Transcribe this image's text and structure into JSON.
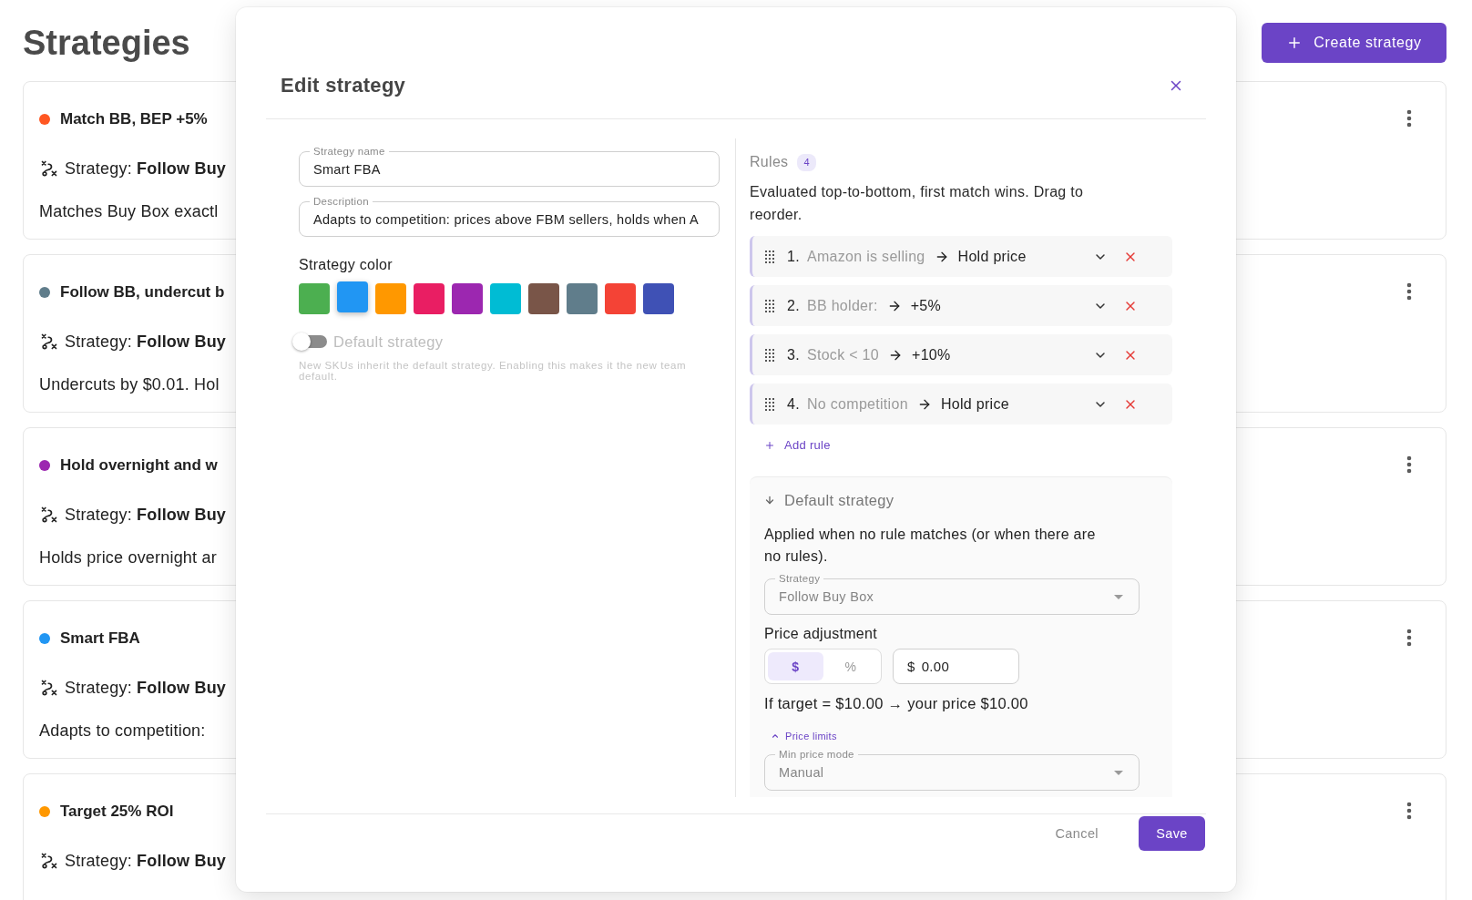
{
  "page": {
    "title": "Strategies",
    "create_button": "Create strategy"
  },
  "strategies": [
    {
      "name": "Match BB, BEP +5%",
      "color": "#ff5722",
      "strategy": "Strategy: **Follow Buy**",
      "description": "Matches Buy Box exactl"
    },
    {
      "name": "Follow BB, undercut b",
      "color": "#607d8b",
      "strategy": "Strategy: **Follow Buy**",
      "description": "Undercuts by $0.01. Hol"
    },
    {
      "name": "Hold overnight and w",
      "color": "#9c27b0",
      "strategy": "Strategy: **Follow Buy**",
      "description": "Holds price overnight ar"
    },
    {
      "name": "Smart FBA",
      "color": "#2196f3",
      "strategy": "Strategy: **Follow Buy**",
      "description": "Adapts to competition:"
    },
    {
      "name": "Target 25% ROI",
      "color": "#ff9800",
      "strategy": "Strategy: **Follow Buy**"
    }
  ],
  "dialog": {
    "title": "Edit strategy",
    "fields": [
      {
        "label": "Strategy name",
        "value": "Smart FBA"
      },
      {
        "label": "Description",
        "value": "Adapts to competition: prices above FBM sellers, holds when A"
      }
    ],
    "color_label": "Strategy color",
    "colors": [
      {
        "color": "#4caf50",
        "selected": false
      },
      {
        "color": "#2196f3",
        "selected": true
      },
      {
        "color": "#ff9800",
        "selected": false
      },
      {
        "color": "#e91e63",
        "selected": false
      },
      {
        "color": "#9c27b0",
        "selected": false
      },
      {
        "color": "#00bcd4",
        "selected": false
      },
      {
        "color": "#795548",
        "selected": false
      },
      {
        "color": "#607d8b",
        "selected": false
      },
      {
        "color": "#f44336",
        "selected": false
      },
      {
        "color": "#3f51b5",
        "selected": false
      }
    ],
    "default_toggle": {
      "label": "Default strategy",
      "on": false,
      "disabled": true,
      "help": "New SKUs inherit the default strategy. Enabling this makes it the new team default."
    },
    "rules": {
      "title": "Rules",
      "count": "4",
      "hint": "Evaluated top-to-bottom, first match wins. Drag to reorder.",
      "items": [
        {
          "number": "1.",
          "condition": "Amazon is selling",
          "action": "Hold price",
          "expanded": false
        },
        {
          "number": "2.",
          "condition": "BB holder:",
          "action": "+5%",
          "expanded": false
        },
        {
          "number": "3.",
          "condition": "Stock < 10",
          "action": "+10%",
          "expanded": false
        },
        {
          "number": "4.",
          "condition": "No competition",
          "action": "Hold price",
          "expanded": false
        }
      ],
      "add_label": "Add rule"
    },
    "fallback": {
      "title": "Default strategy",
      "text": "Applied when no rule matches (or when there are no rules).",
      "strategy_select": {
        "label": "Strategy",
        "value": "Follow Buy Box",
        "disabled": true
      },
      "adjustment_label": "Price adjustment",
      "units": [
        {
          "label": "$",
          "selected": true
        },
        {
          "label": "%",
          "selected": false
        }
      ],
      "amount": {
        "prefix": "$",
        "value": "0.00"
      },
      "preview": "If target = $10.00 → your price $10.00",
      "limits": {
        "label": "Price limits",
        "expanded": true
      },
      "min_mode": {
        "label": "Min price mode",
        "value": "Manual",
        "disabled": true
      }
    },
    "buttons": [
      {
        "label": "Cancel",
        "kind": "text"
      },
      {
        "label": "Save",
        "kind": "primary"
      }
    ]
  }
}
